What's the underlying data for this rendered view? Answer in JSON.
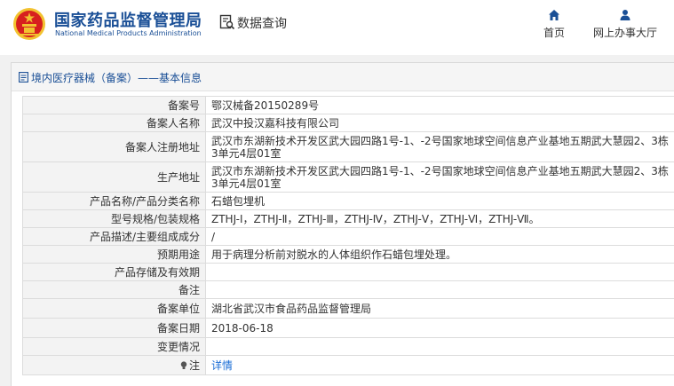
{
  "header": {
    "brand_cn": "国家药品监督管理局",
    "brand_en": "National Medical Products Administration",
    "query_label": "数据查询",
    "nav": [
      {
        "label": "首页",
        "icon": "home-icon"
      },
      {
        "label": "网上办事大厅",
        "icon": "user-icon"
      }
    ]
  },
  "panel": {
    "title": "境内医疗器械（备案）——基本信息"
  },
  "rows": [
    {
      "key": "备案号",
      "value": "鄂汉械备20150289号"
    },
    {
      "key": "备案人名称",
      "value": "武汉中投汉嘉科技有限公司"
    },
    {
      "key": "备案人注册地址",
      "value": "武汉市东湖新技术开发区武大园四路1号-1、-2号国家地球空间信息产业基地五期武大慧园2、3栋3单元4层01室"
    },
    {
      "key": "生产地址",
      "value": "武汉市东湖新技术开发区武大园四路1号-1、-2号国家地球空间信息产业基地五期武大慧园2、3栋3单元4层01室"
    },
    {
      "key": "产品名称/产品分类名称",
      "value": "石蜡包埋机"
    },
    {
      "key": "型号规格/包装规格",
      "value": "ZTHJ-Ⅰ，ZTHJ-Ⅱ，ZTHJ-Ⅲ，ZTHJ-Ⅳ，ZTHJ-Ⅴ，ZTHJ-Ⅵ，ZTHJ-Ⅶ。"
    },
    {
      "key": "产品描述/主要组成成分",
      "value": "/"
    },
    {
      "key": "预期用途",
      "value": "用于病理分析前对脱水的人体组织作石蜡包埋处理。"
    },
    {
      "key": "产品存储及有效期",
      "value": ""
    },
    {
      "key": "备注",
      "value": ""
    },
    {
      "key": "备案单位",
      "value": "湖北省武汉市食品药品监督管理局"
    },
    {
      "key": "备案日期",
      "value": "2018-06-18"
    },
    {
      "key": "变更情况",
      "value": ""
    },
    {
      "key": "注",
      "value": "详情"
    }
  ],
  "colors": {
    "brand_blue": "#1a4f96",
    "link_blue": "#1a6dd6",
    "emblem_red": "#d7201f",
    "emblem_gold": "#f2c230"
  }
}
